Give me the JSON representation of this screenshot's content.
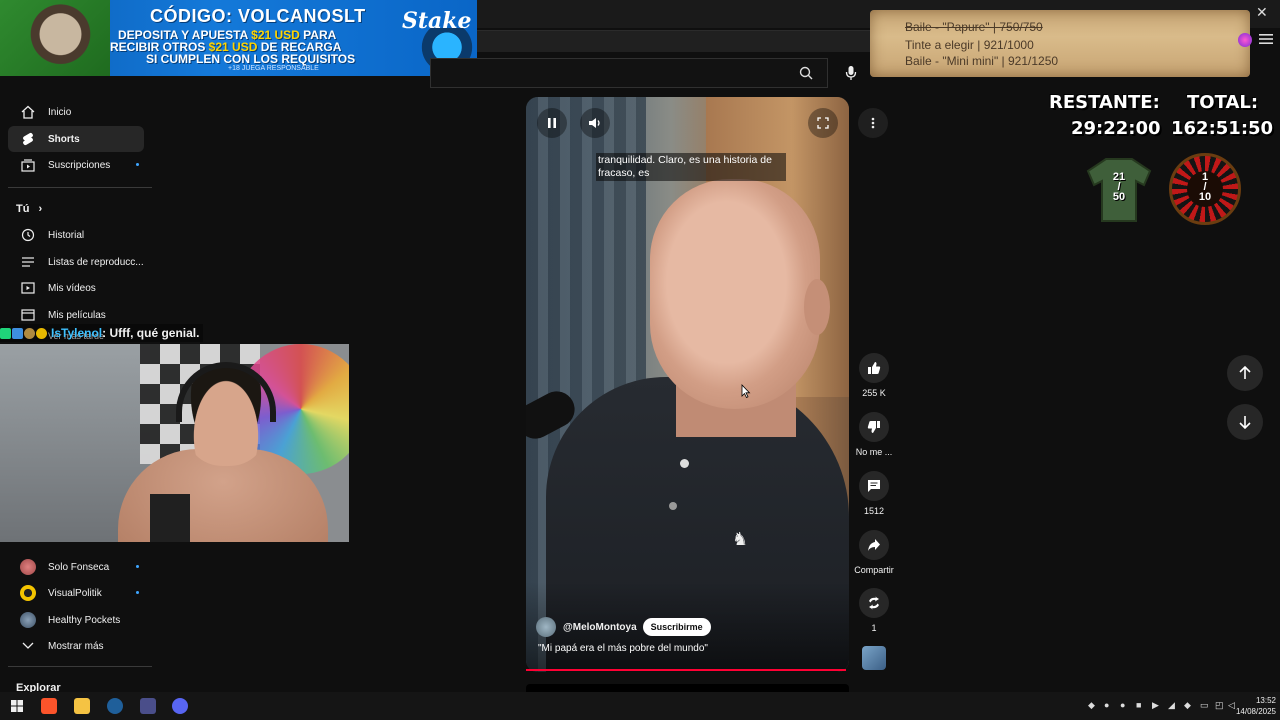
{
  "banner": {
    "code": "CÓDIGO: VOLCANOSLT",
    "line1_a": "DEPOSITA Y APUESTA ",
    "line1_hl": "$21 USD",
    "line1_b": " PARA",
    "line2_a": "RECIBIR OTROS ",
    "line2_hl": "$21 USD",
    "line2_b": " DE RECARGA",
    "line3": "SI CUMPLEN CON LOS REQUISITOS",
    "small": "+18 JUEGA RESPONSABLE",
    "brand": "Stake"
  },
  "goals": [
    {
      "text": "Baile - \"Papure\" | 750/750",
      "done": true
    },
    {
      "text": "Tinte a elegir | 921/1000",
      "done": false
    },
    {
      "text": "Baile - \"Mini mini\" | 921/1250",
      "done": false
    }
  ],
  "timers": {
    "restante_label": "RESTANTE:",
    "restante_value": "29:22:00",
    "total_label": "TOTAL:",
    "total_value": "162:51:50"
  },
  "shirt_counter": {
    "top": "21",
    "sep": "/",
    "bottom": "50"
  },
  "roulette_counter": {
    "top": "1",
    "sep": "/",
    "bottom": "10"
  },
  "sidebar": {
    "main": [
      {
        "label": "Inicio",
        "icon": "home-icon"
      },
      {
        "label": "Shorts",
        "icon": "shorts-icon",
        "active": true
      },
      {
        "label": "Suscripciones",
        "icon": "subscriptions-icon",
        "dot": true
      }
    ],
    "you_header": "Tú",
    "you": [
      {
        "label": "Historial",
        "icon": "history-icon"
      },
      {
        "label": "Listas de reproducc...",
        "icon": "playlist-icon"
      },
      {
        "label": "Mis vídeos",
        "icon": "my-videos-icon"
      },
      {
        "label": "Mis películas",
        "icon": "movies-icon"
      },
      {
        "label": "Ver más tarde",
        "icon": "watch-later-icon"
      }
    ],
    "subs": [
      {
        "label": "Solo Fonseca",
        "dot": true
      },
      {
        "label": "VisualPolitik",
        "dot": true
      },
      {
        "label": "Healthy Pockets",
        "dot": false
      }
    ],
    "show_more": "Mostrar más",
    "explore": "Explorar"
  },
  "chat": {
    "user": "IsTylenol",
    "message": " : Ufff, qué genial."
  },
  "video": {
    "subtitle": "tranquilidad. Claro, es una historia de fracaso, es",
    "channel": "@MeloMontoya",
    "subscribe": "Suscribirme",
    "title": "\"Mi papá era el más pobre del mundo\"",
    "progress": 0.99
  },
  "actions": {
    "likes": "255 K",
    "dislike": "No me ...",
    "comments": "1512",
    "share": "Compartir",
    "remix": "1"
  },
  "taskbar": {
    "time": "13:52",
    "date": "14/08/2025"
  },
  "colors": {
    "accent": "#3ea6ff",
    "progress": "#ff0033",
    "chat_name": "#3ec1ff"
  }
}
